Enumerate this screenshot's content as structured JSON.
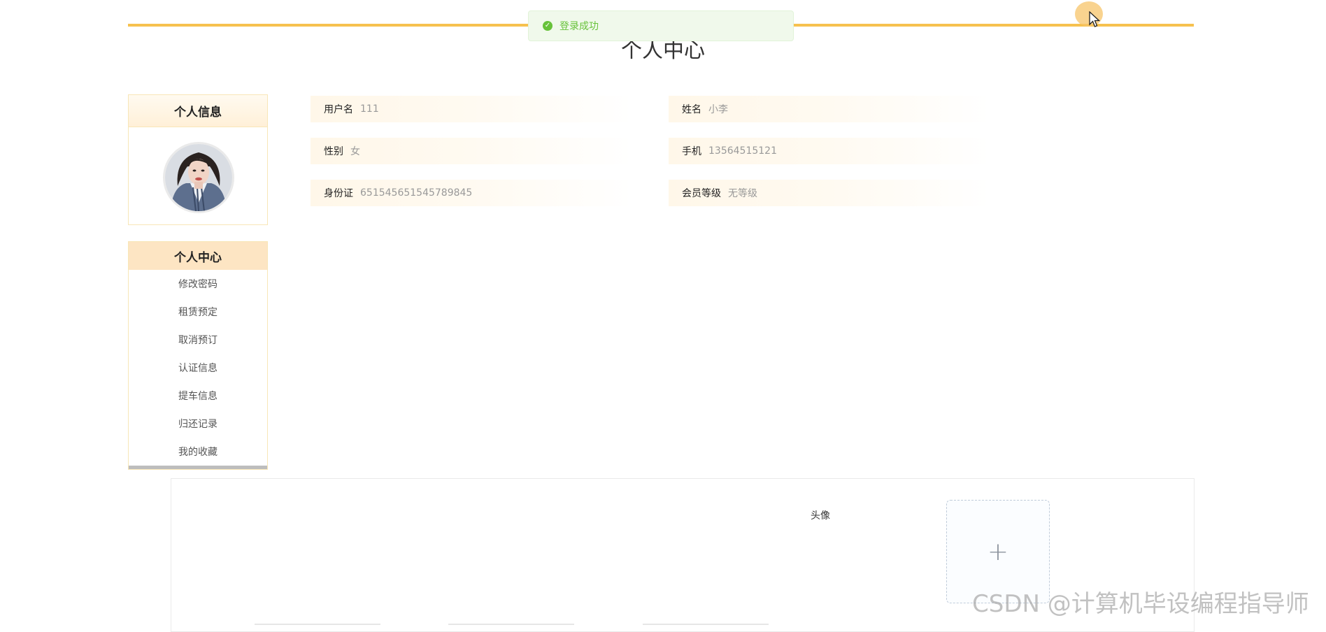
{
  "toast": {
    "icon": "check-circle-icon",
    "message": "登录成功"
  },
  "page": {
    "title": "个人中心"
  },
  "profile_card": {
    "title": "个人信息"
  },
  "fields": [
    {
      "label": "用户名",
      "value": "111"
    },
    {
      "label": "姓名",
      "value": "小李"
    },
    {
      "label": "性别",
      "value": "女"
    },
    {
      "label": "手机",
      "value": "13564515121"
    },
    {
      "label": "身份证",
      "value": "651545651545789845"
    },
    {
      "label": "会员等级",
      "value": "无等级"
    }
  ],
  "menu": {
    "title": "个人中心",
    "items": [
      "修改密码",
      "租赁预定",
      "取消预订",
      "认证信息",
      "提车信息",
      "归还记录",
      "我的收藏"
    ]
  },
  "form": {
    "avatar_label": "头像",
    "upload_icon": "plus-icon"
  },
  "watermark": "CSDN @计算机毕设编程指导师",
  "colors": {
    "accent": "#f6c14f",
    "success": "#67c23a",
    "menu_head": "#fde5c3"
  }
}
